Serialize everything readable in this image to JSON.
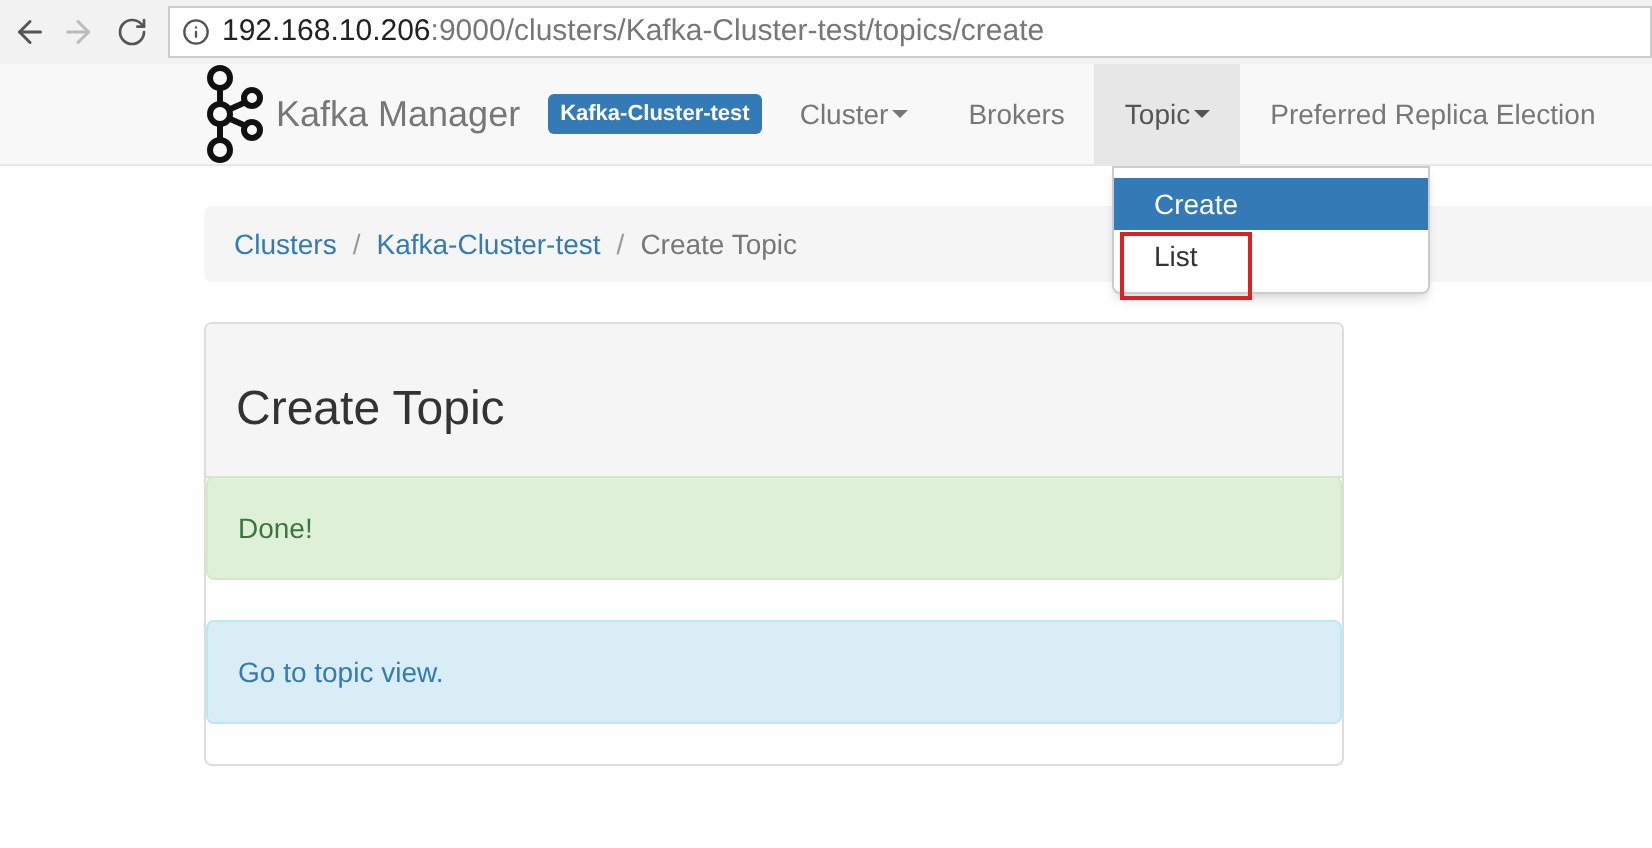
{
  "browser": {
    "url_host": "192.168.10.206",
    "url_path": ":9000/clusters/Kafka-Cluster-test/topics/create"
  },
  "navbar": {
    "brand": "Kafka Manager",
    "cluster_badge": "Kafka-Cluster-test",
    "items": [
      {
        "label": "Cluster",
        "dropdown": true,
        "selected": false
      },
      {
        "label": "Brokers",
        "dropdown": false,
        "selected": false
      },
      {
        "label": "Topic",
        "dropdown": true,
        "selected": true
      },
      {
        "label": "Preferred Replica Election",
        "dropdown": false,
        "selected": false
      }
    ]
  },
  "dropdown_menu": {
    "items": [
      {
        "label": "Create",
        "selected": true,
        "highlighted": false
      },
      {
        "label": "List",
        "selected": false,
        "highlighted": true
      }
    ]
  },
  "breadcrumb": [
    {
      "label": "Clusters",
      "kind": "link"
    },
    {
      "label": "Kafka-Cluster-test",
      "kind": "link",
      "separator": "/"
    },
    {
      "label": "Create Topic",
      "kind": "current",
      "separator": "/"
    }
  ],
  "panel": {
    "title": "Create Topic",
    "alerts": [
      {
        "kind": "success",
        "text": "Done!"
      },
      {
        "kind": "info",
        "text": "Go to topic view."
      }
    ]
  }
}
